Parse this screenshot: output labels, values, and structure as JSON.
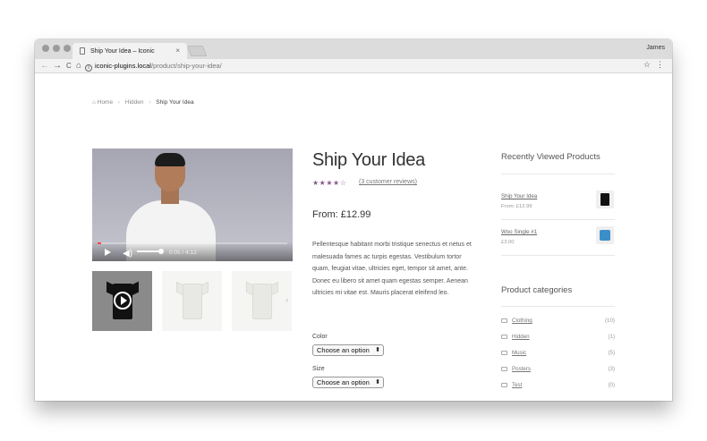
{
  "browser": {
    "tab_title": "Ship Your Idea – Iconic",
    "tab_close": "×",
    "profile_name": "James",
    "url_host": "iconic-plugins.local",
    "url_path": "/product/ship-your-idea/",
    "back_glyph": "←",
    "forward_glyph": "→",
    "reload_glyph": "C",
    "home_glyph": "⌂",
    "info_glyph": "i",
    "bookmark_glyph": "☆",
    "menu_glyph": "⋮"
  },
  "breadcrumb": {
    "home_icon": "⌂",
    "home": "Home",
    "category": "Hidden",
    "current": "Ship Your Idea",
    "separator": "›"
  },
  "video": {
    "time": "0:05 / 4:12",
    "progress": 0.02,
    "volume": 0.85,
    "volume_glyph": "◀)"
  },
  "gallery": {
    "next_glyph": "›"
  },
  "product": {
    "title": "Ship Your Idea",
    "rating_stars": "★★★★☆",
    "rating": 4.5,
    "reviews_link": "(3 customer reviews)",
    "price": "From: £12.99",
    "description": "Pellentesque habitant morbi tristique senectus et netus et malesuada fames ac turpis egestas. Vestibulum tortor quam, feugiat vitae, ultricies eget, tempor sit amet, ante. Donec eu libero sit amet quam egestas semper. Aenean ultricies mi vitae est. Mauris placerat eleifend leo.",
    "color_label": "Color",
    "color_select": "Choose an option",
    "size_label": "Size",
    "size_select": "Choose an option",
    "select_chevron": "⬍"
  },
  "recently_viewed": {
    "title": "Recently Viewed Products",
    "items": [
      {
        "name": "Ship Your Idea",
        "price": "From: £12.99"
      },
      {
        "name": "Woo Single #1",
        "price": "£3.00"
      }
    ]
  },
  "categories": {
    "title": "Product categories",
    "items": [
      {
        "name": "Clothing",
        "count": "(10)"
      },
      {
        "name": "Hidden",
        "count": "(1)"
      },
      {
        "name": "Music",
        "count": "(5)"
      },
      {
        "name": "Posters",
        "count": "(3)"
      },
      {
        "name": "Test",
        "count": "(0)"
      }
    ]
  },
  "colors": {
    "accent_purple": "#8a5a89",
    "text_dark": "#333333",
    "link_gray": "#777777",
    "chrome_bg": "#dcdcdc"
  }
}
